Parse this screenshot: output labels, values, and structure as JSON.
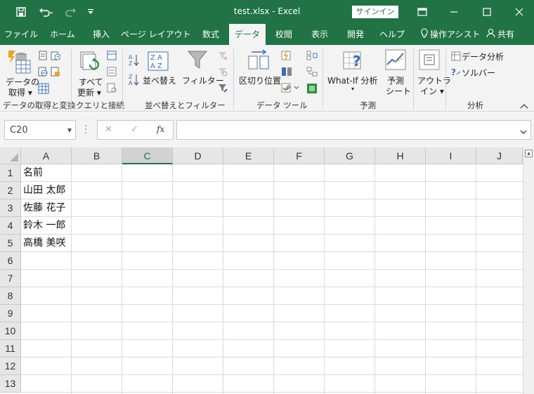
{
  "window": {
    "title": "test.xlsx  -  Excel",
    "signin_label": "サインイン",
    "accent_color": "#217346"
  },
  "tabs": [
    {
      "label": "ファイル",
      "active": false
    },
    {
      "label": "ホーム",
      "active": false
    },
    {
      "label": "挿入",
      "active": false
    },
    {
      "label": "ページ レイアウト",
      "active": false
    },
    {
      "label": "数式",
      "active": false
    },
    {
      "label": "データ",
      "active": true
    },
    {
      "label": "校閲",
      "active": false
    },
    {
      "label": "表示",
      "active": false
    },
    {
      "label": "開発",
      "active": false
    },
    {
      "label": "ヘルプ",
      "active": false
    },
    {
      "label": "操作アシスト",
      "active": false
    },
    {
      "label": "共有",
      "active": false
    }
  ],
  "ribbon": {
    "get_data_label_1": "データの",
    "get_data_label_2": "取得",
    "refresh_all_label_1": "すべて",
    "refresh_all_label_2": "更新",
    "sort_label": "並べ替え",
    "filter_label": "フィルター",
    "text_to_columns_label": "区切り位置",
    "whatif_label": "What-If 分析",
    "forecast_label_1": "予測",
    "forecast_label_2": "シート",
    "outline_label_1": "アウトラ",
    "outline_label_2": "イン",
    "data_analysis_label": "データ分析",
    "solver_label": "ソルバー",
    "groups": {
      "get_transform": "データの取得と変換",
      "queries": "クエリと接続",
      "sort_filter": "並べ替えとフィルター",
      "data_tools": "データ ツール",
      "forecast": "予測",
      "analysis": "分析"
    }
  },
  "formula_bar": {
    "name_box": "C20",
    "cancel_symbol": "✕",
    "enter_symbol": "✓",
    "fx_symbol": "fx",
    "formula": ""
  },
  "sheet": {
    "columns": [
      "A",
      "B",
      "C",
      "D",
      "E",
      "F",
      "G",
      "H",
      "I",
      "J"
    ],
    "selected_column": "C",
    "rows": [
      "1",
      "2",
      "3",
      "4",
      "5",
      "6",
      "7",
      "8",
      "9",
      "10",
      "11",
      "12",
      "13"
    ],
    "cells_a": [
      "名前",
      "山田 太郎",
      "佐藤 花子",
      "鈴木 一郎",
      "高橋 美咲"
    ]
  }
}
